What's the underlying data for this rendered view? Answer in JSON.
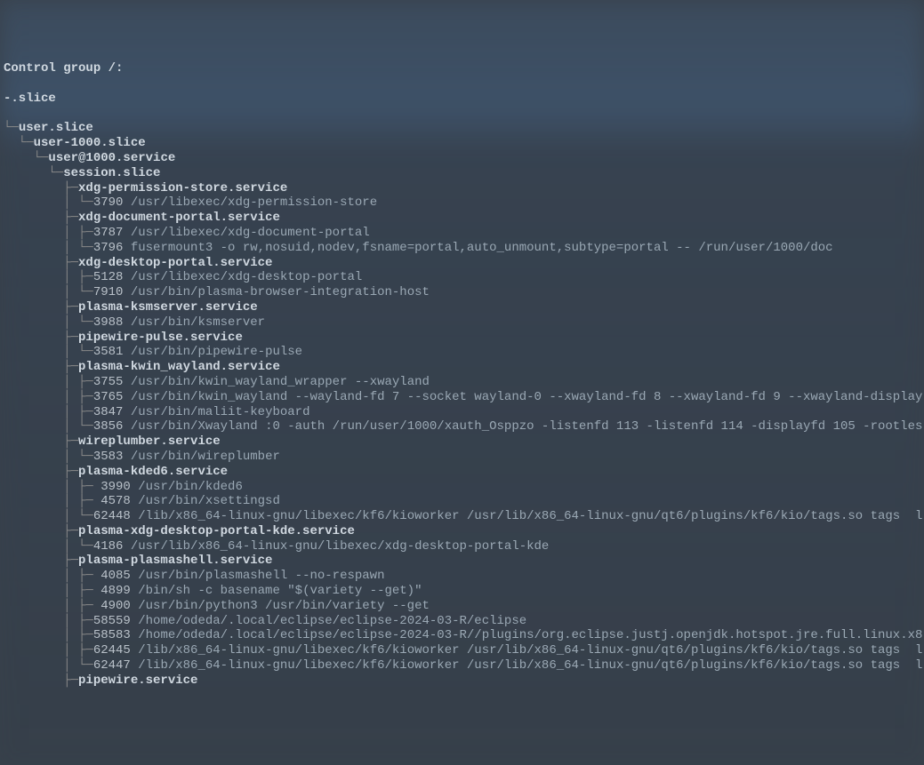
{
  "header": "Control group /:",
  "root": "-.slice",
  "tree": [
    {
      "prefix": "└─",
      "name": "user.slice",
      "class": "slice"
    },
    {
      "prefix": "  └─",
      "name": "user-1000.slice",
      "class": "slice"
    },
    {
      "prefix": "    └─",
      "name": "user@1000.service",
      "class": "svc"
    },
    {
      "prefix": "      └─",
      "name": "session.slice",
      "class": "slice"
    },
    {
      "prefix": "        ├─",
      "name": "xdg-permission-store.service",
      "class": "svc"
    },
    {
      "prefix": "        │ └─",
      "pid": "3790",
      "cmd": "/usr/libexec/xdg-permission-store"
    },
    {
      "prefix": "        ├─",
      "name": "xdg-document-portal.service",
      "class": "svc"
    },
    {
      "prefix": "        │ ├─",
      "pid": "3787",
      "cmd": "/usr/libexec/xdg-document-portal"
    },
    {
      "prefix": "        │ └─",
      "pid": "3796",
      "cmd": "fusermount3 -o rw,nosuid,nodev,fsname=portal,auto_unmount,subtype=portal -- /run/user/1000/doc"
    },
    {
      "prefix": "        ├─",
      "name": "xdg-desktop-portal.service",
      "class": "svc"
    },
    {
      "prefix": "        │ ├─",
      "pid": "5128",
      "cmd": "/usr/libexec/xdg-desktop-portal"
    },
    {
      "prefix": "        │ └─",
      "pid": "7910",
      "cmd": "/usr/bin/plasma-browser-integration-host"
    },
    {
      "prefix": "        ├─",
      "name": "plasma-ksmserver.service",
      "class": "svc"
    },
    {
      "prefix": "        │ └─",
      "pid": "3988",
      "cmd": "/usr/bin/ksmserver"
    },
    {
      "prefix": "        ├─",
      "name": "pipewire-pulse.service",
      "class": "svc"
    },
    {
      "prefix": "        │ └─",
      "pid": "3581",
      "cmd": "/usr/bin/pipewire-pulse"
    },
    {
      "prefix": "        ├─",
      "name": "plasma-kwin_wayland.service",
      "class": "svc"
    },
    {
      "prefix": "        │ ├─",
      "pid": "3755",
      "cmd": "/usr/bin/kwin_wayland_wrapper --xwayland"
    },
    {
      "prefix": "        │ ├─",
      "pid": "3765",
      "cmd": "/usr/bin/kwin_wayland --wayland-fd 7 --socket wayland-0 --xwayland-fd 8 --xwayland-fd 9 --xwayland-display"
    },
    {
      "prefix": "        │ ├─",
      "pid": "3847",
      "cmd": "/usr/bin/maliit-keyboard"
    },
    {
      "prefix": "        │ └─",
      "pid": "3856",
      "cmd": "/usr/bin/Xwayland :0 -auth /run/user/1000/xauth_Osppzo -listenfd 113 -listenfd 114 -displayfd 105 -rootles"
    },
    {
      "prefix": "        ├─",
      "name": "wireplumber.service",
      "class": "svc"
    },
    {
      "prefix": "        │ └─",
      "pid": "3583",
      "cmd": "/usr/bin/wireplumber"
    },
    {
      "prefix": "        ├─",
      "name": "plasma-kded6.service",
      "class": "svc"
    },
    {
      "prefix": "        │ ├─ ",
      "pid": "3990",
      "cmd": "/usr/bin/kded6"
    },
    {
      "prefix": "        │ ├─ ",
      "pid": "4578",
      "cmd": "/usr/bin/xsettingsd"
    },
    {
      "prefix": "        │ └─",
      "pid": "62448",
      "cmd": "/lib/x86_64-linux-gnu/libexec/kf6/kioworker /usr/lib/x86_64-linux-gnu/qt6/plugins/kf6/kio/tags.so tags  l"
    },
    {
      "prefix": "        ├─",
      "name": "plasma-xdg-desktop-portal-kde.service",
      "class": "svc"
    },
    {
      "prefix": "        │ └─",
      "pid": "4186",
      "cmd": "/usr/lib/x86_64-linux-gnu/libexec/xdg-desktop-portal-kde"
    },
    {
      "prefix": "        ├─",
      "name": "plasma-plasmashell.service",
      "class": "svc"
    },
    {
      "prefix": "        │ ├─ ",
      "pid": "4085",
      "cmd": "/usr/bin/plasmashell --no-respawn"
    },
    {
      "prefix": "        │ ├─ ",
      "pid": "4899",
      "cmd": "/bin/sh -c basename \"$(variety --get)\""
    },
    {
      "prefix": "        │ ├─ ",
      "pid": "4900",
      "cmd": "/usr/bin/python3 /usr/bin/variety --get"
    },
    {
      "prefix": "        │ ├─",
      "pid": "58559",
      "cmd": "/home/odeda/.local/eclipse/eclipse-2024-03-R/eclipse"
    },
    {
      "prefix": "        │ ├─",
      "pid": "58583",
      "cmd": "/home/odeda/.local/eclipse/eclipse-2024-03-R//plugins/org.eclipse.justj.openjdk.hotspot.jre.full.linux.x8"
    },
    {
      "prefix": "        │ ├─",
      "pid": "62445",
      "cmd": "/lib/x86_64-linux-gnu/libexec/kf6/kioworker /usr/lib/x86_64-linux-gnu/qt6/plugins/kf6/kio/tags.so tags  l"
    },
    {
      "prefix": "        │ └─",
      "pid": "62447",
      "cmd": "/lib/x86_64-linux-gnu/libexec/kf6/kioworker /usr/lib/x86_64-linux-gnu/qt6/plugins/kf6/kio/tags.so tags  l"
    },
    {
      "prefix": "        ├─",
      "name": "pipewire.service",
      "class": "svc"
    }
  ]
}
